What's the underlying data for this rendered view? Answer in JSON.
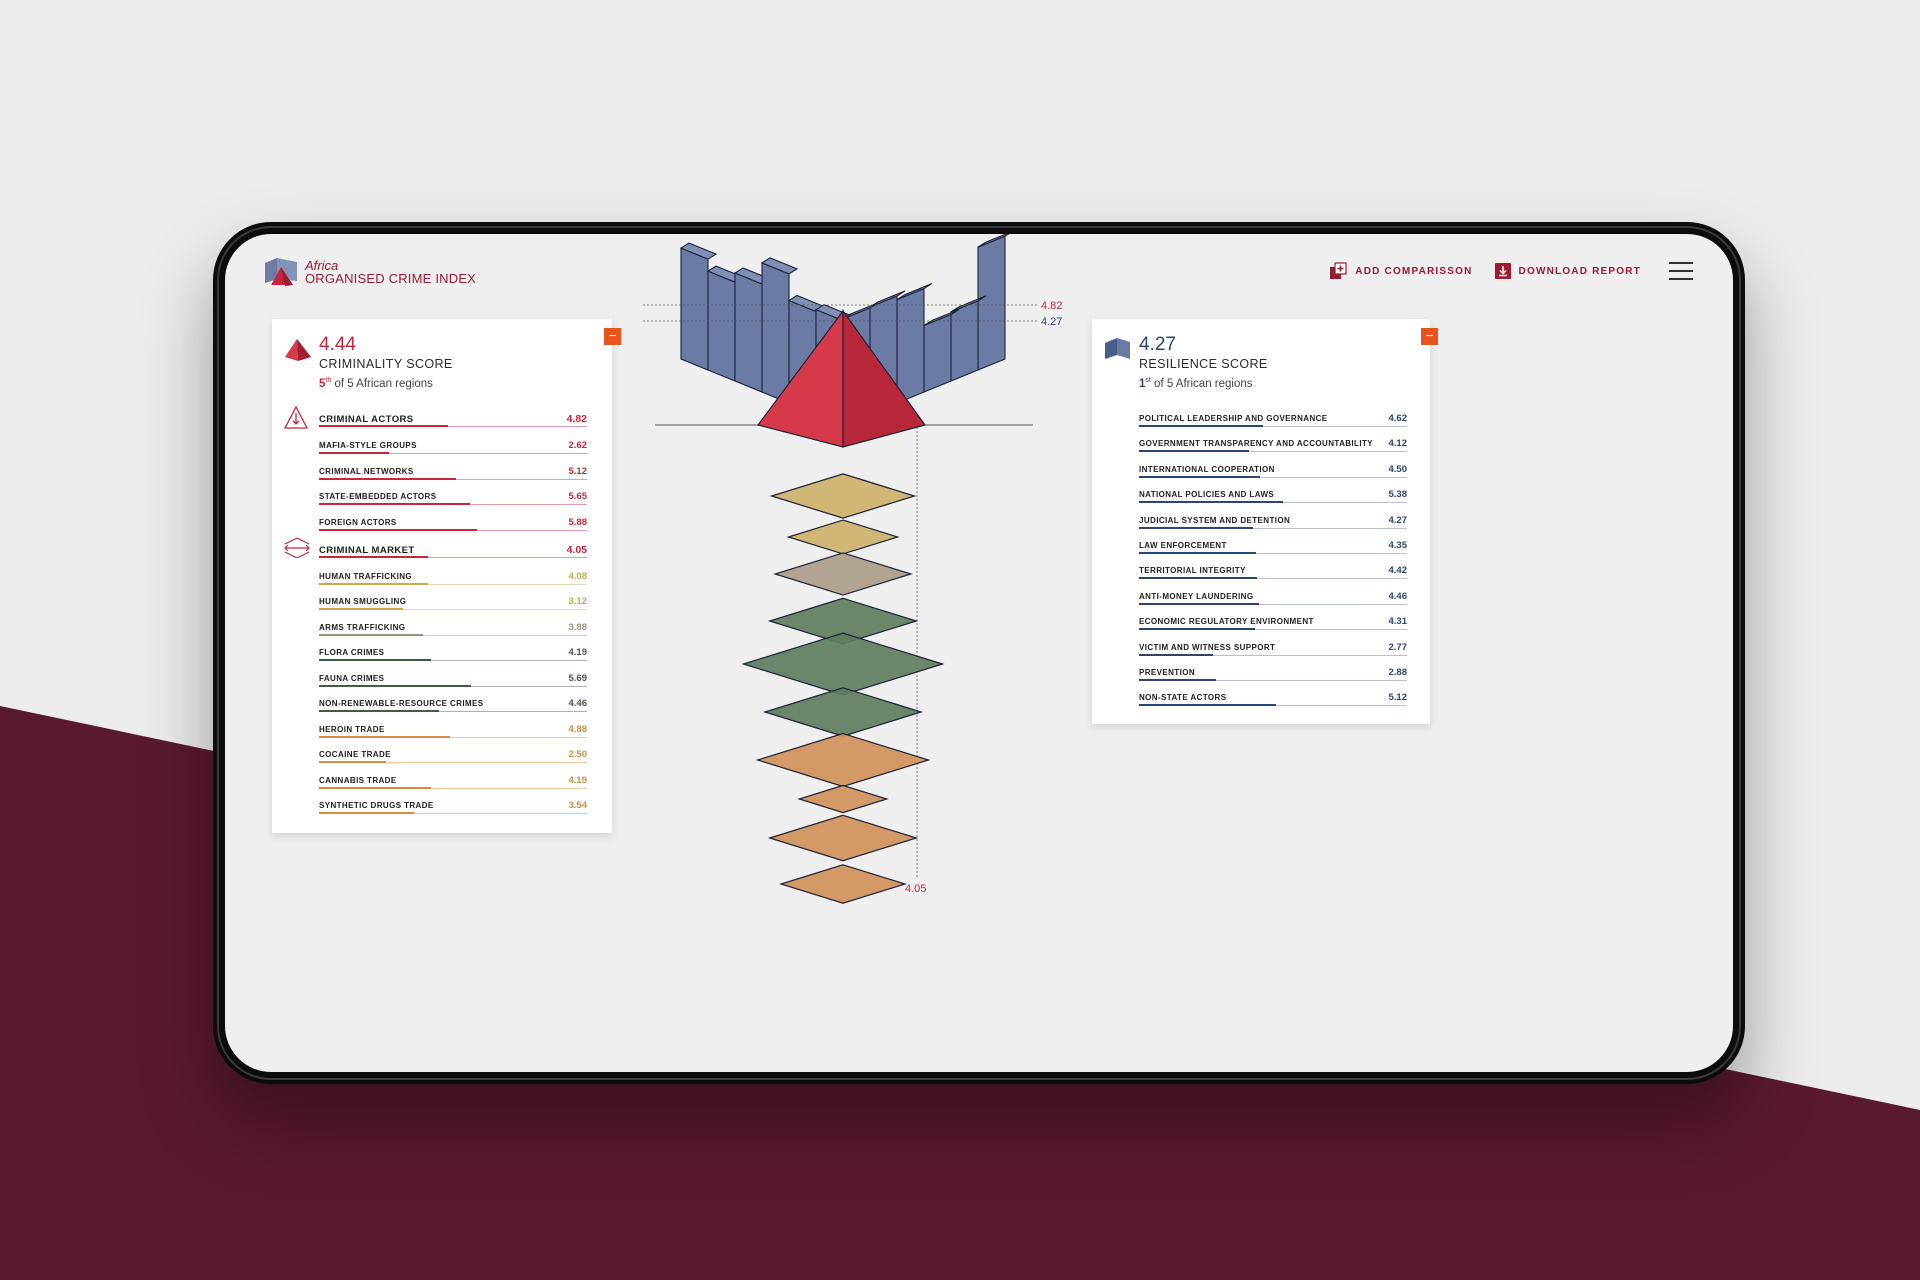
{
  "colors": {
    "brand": "#9b1c2e",
    "criminality": "#c8273a",
    "resilience": "#2b4576",
    "collapse": "#e8541c",
    "maroon_bg": "#5a1a2e"
  },
  "header": {
    "brand_line1": "Africa",
    "brand_line2": "ORGANISED CRIME INDEX",
    "actions": [
      {
        "label": "ADD COMPARISSON",
        "icon": "add-comparison-icon"
      },
      {
        "label": "DOWNLOAD REPORT",
        "icon": "download-icon"
      }
    ],
    "menu_icon": "hamburger-menu-icon"
  },
  "criminality": {
    "score": "4.44",
    "title": "CRIMINALITY SCORE",
    "rank_num": "5",
    "rank_suffix": "th",
    "rank_text": " of 5 African regions",
    "collapse_label": "−",
    "categories": [
      {
        "name": "CRIMINAL ACTORS",
        "value": "4.82",
        "icon": "criminal-actors-icon",
        "items": [
          {
            "name": "MAFIA-STYLE GROUPS",
            "value": "2.62",
            "color": "#c8273a"
          },
          {
            "name": "CRIMINAL NETWORKS",
            "value": "5.12",
            "color": "#c8273a"
          },
          {
            "name": "STATE-EMBEDDED ACTORS",
            "value": "5.65",
            "color": "#c8273a"
          },
          {
            "name": "FOREIGN ACTORS",
            "value": "5.88",
            "color": "#c8273a"
          }
        ]
      },
      {
        "name": "CRIMINAL MARKET",
        "value": "4.05",
        "icon": "criminal-market-icon",
        "items": [
          {
            "name": "HUMAN TRAFFICKING",
            "value": "4.08",
            "color": "#c9ab4e"
          },
          {
            "name": "HUMAN SMUGGLING",
            "value": "3.12",
            "color": "#c9ab4e"
          },
          {
            "name": "ARMS TRAFFICKING",
            "value": "3.88",
            "color": "#a08e7a"
          },
          {
            "name": "FLORA CRIMES",
            "value": "4.19",
            "color": "#3f5e3f"
          },
          {
            "name": "FAUNA CRIMES",
            "value": "5.69",
            "color": "#3f5e3f"
          },
          {
            "name": "NON-RENEWABLE-RESOURCE CRIMES",
            "value": "4.46",
            "color": "#3f5e3f"
          },
          {
            "name": "HEROIN TRADE",
            "value": "4.88",
            "color": "#d98a3e"
          },
          {
            "name": "COCAINE TRADE",
            "value": "2.50",
            "color": "#d98a3e"
          },
          {
            "name": "CANNABIS TRADE",
            "value": "4.19",
            "color": "#d98a3e"
          },
          {
            "name": "SYNTHETIC DRUGS TRADE",
            "value": "3.54",
            "color": "#d98a3e"
          }
        ]
      }
    ]
  },
  "resilience": {
    "score": "4.27",
    "title": "RESILIENCE SCORE",
    "rank_num": "1",
    "rank_suffix": "st",
    "rank_text": " of 5 African regions",
    "collapse_label": "−",
    "items": [
      {
        "name": "POLITICAL LEADERSHIP AND GOVERNANCE",
        "value": "4.62"
      },
      {
        "name": "GOVERNMENT TRANSPARENCY AND ACCOUNTABILITY",
        "value": "4.12"
      },
      {
        "name": "INTERNATIONAL COOPERATION",
        "value": "4.50"
      },
      {
        "name": "NATIONAL POLICIES AND LAWS",
        "value": "5.38"
      },
      {
        "name": "JUDICIAL SYSTEM AND DETENTION",
        "value": "4.27"
      },
      {
        "name": "LAW ENFORCEMENT",
        "value": "4.35"
      },
      {
        "name": "TERRITORIAL INTEGRITY",
        "value": "4.42"
      },
      {
        "name": "ANTI-MONEY LAUNDERING",
        "value": "4.46"
      },
      {
        "name": "ECONOMIC REGULATORY ENVIRONMENT",
        "value": "4.31"
      },
      {
        "name": "VICTIM AND WITNESS SUPPORT",
        "value": "2.77"
      },
      {
        "name": "PREVENTION",
        "value": "2.88"
      },
      {
        "name": "NON-STATE ACTORS",
        "value": "5.12"
      }
    ]
  },
  "chart_data": {
    "type": "bar",
    "scale_max": 10,
    "annotations": [
      "4.82",
      "4.27",
      "4.05"
    ],
    "resilience_bars": [
      4.62,
      4.12,
      4.5,
      5.38,
      4.27,
      4.35,
      4.42,
      4.46,
      4.31,
      2.77,
      2.88,
      5.12
    ],
    "criminal_actors_pyramid": 4.82,
    "criminal_market_layers": [
      {
        "value": 4.08,
        "color": "#cdb26a"
      },
      {
        "value": 3.12,
        "color": "#cdb26a"
      },
      {
        "value": 3.88,
        "color": "#ad9d8a"
      },
      {
        "value": 4.19,
        "color": "#5f7d5f"
      },
      {
        "value": 5.69,
        "color": "#5f7d5f"
      },
      {
        "value": 4.46,
        "color": "#5f7d5f"
      },
      {
        "value": 4.88,
        "color": "#d0915a"
      },
      {
        "value": 2.5,
        "color": "#d0915a"
      },
      {
        "value": 4.19,
        "color": "#d0915a"
      },
      {
        "value": 3.54,
        "color": "#d0915a"
      }
    ]
  }
}
